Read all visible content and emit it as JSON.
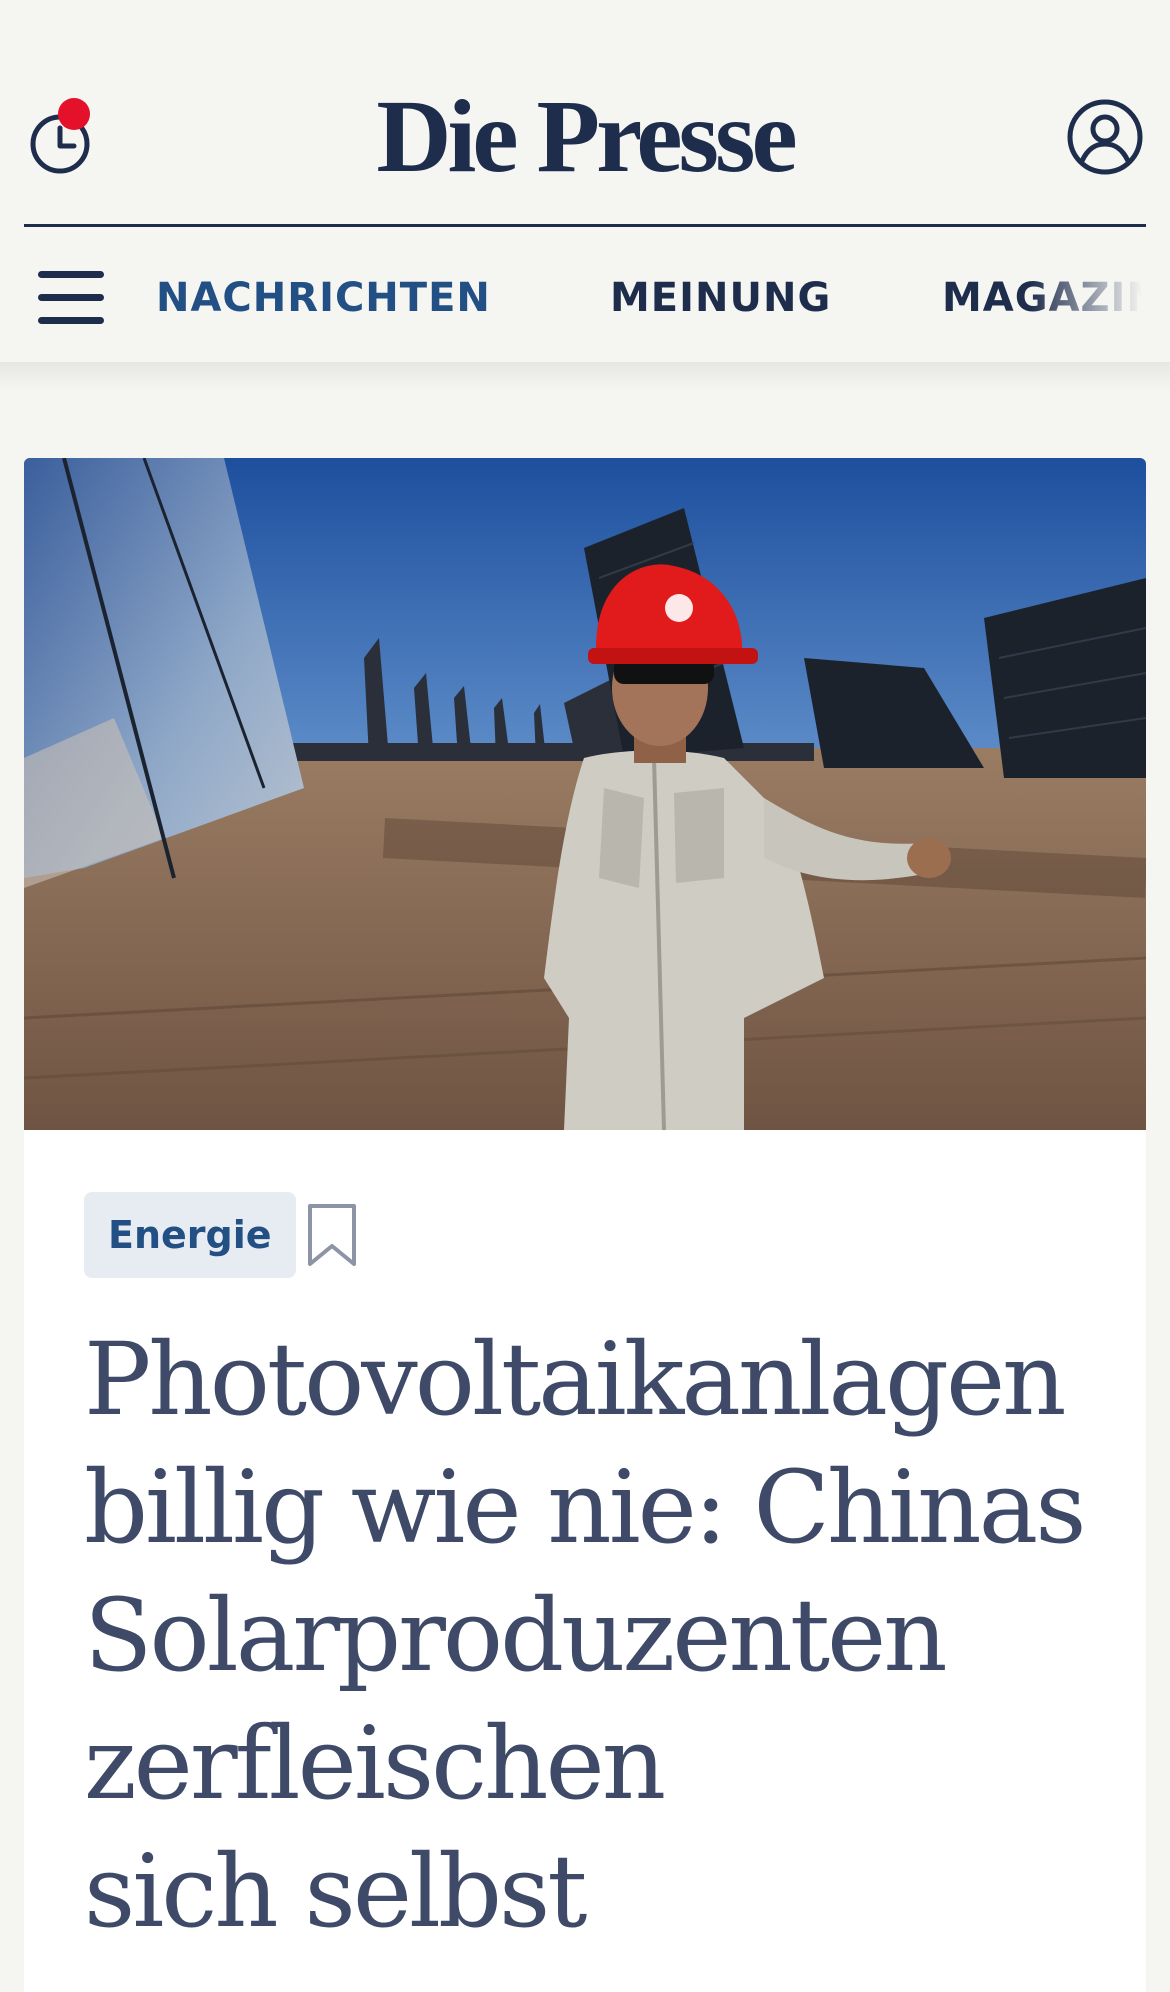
{
  "header": {
    "logo": "Die Presse",
    "history_icon": "history-clock-icon",
    "account_icon": "user-account-icon",
    "notification_color": "#e5112b",
    "brand_color": "#1f2d4d"
  },
  "nav": {
    "menu_icon": "hamburger-menu-icon",
    "items": [
      {
        "label": "NACHRICHTEN",
        "active": true
      },
      {
        "label": "MEINUNG",
        "active": false
      },
      {
        "label": "MAGAZIN",
        "active": false
      }
    ],
    "active_color": "#224f84"
  },
  "article": {
    "image_alt": "Arbeiter mit rotem Helm vor Solarpaneelen in der Wüste",
    "tag": "Energie",
    "bookmark_icon": "bookmark-icon",
    "headline_lines": [
      "Photovoltaikanlagen",
      "billig wie nie: Chinas",
      "Solarproduzenten",
      "zerfleischen",
      "sich selbst"
    ]
  }
}
